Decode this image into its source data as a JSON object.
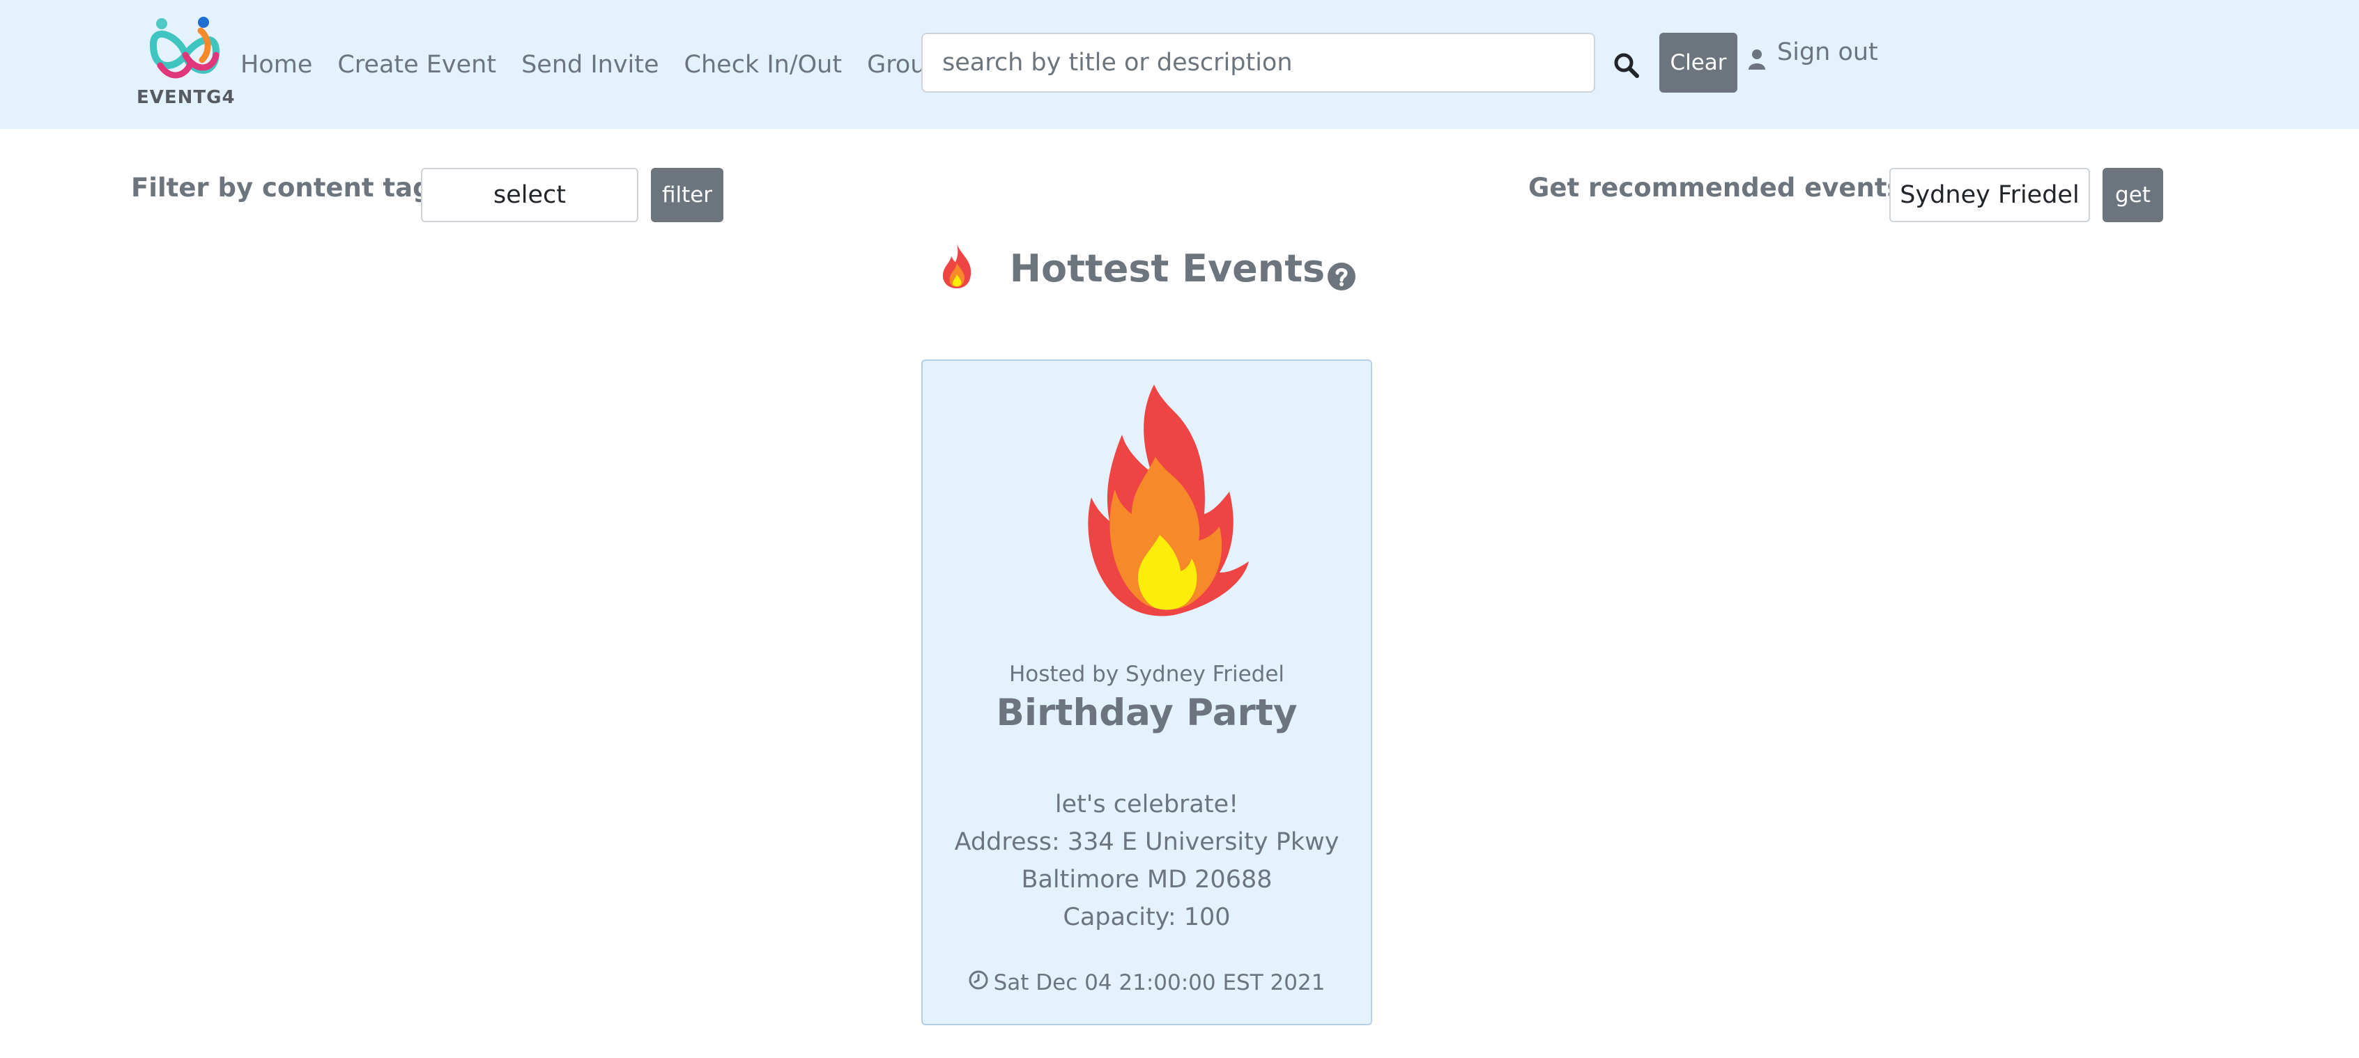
{
  "navbar": {
    "brand_text": "EVENTG4",
    "links": [
      {
        "label": "Home"
      },
      {
        "label": "Create Event"
      },
      {
        "label": "Send Invite"
      },
      {
        "label": "Check In/Out"
      },
      {
        "label": "Groups"
      }
    ],
    "search": {
      "placeholder": "search by title or description",
      "value": ""
    },
    "search_icon": "search-icon",
    "clear_label": "Clear",
    "signout_label": "Sign out",
    "user_icon": "user-icon",
    "background_color": "#e3f2fd"
  },
  "filter": {
    "label": "Filter by content tag:",
    "select_value": "select",
    "button_label": "filter"
  },
  "recommend": {
    "label": "Get recommended events:",
    "select_value": "Sydney Friedel",
    "button_label": "get"
  },
  "hottest": {
    "title": "Hottest Events",
    "icon": "fire-icon",
    "help_icon": "question-circle-icon"
  },
  "events": [
    {
      "hosted_by": "Hosted by Sydney Friedel",
      "title": "Birthday Party",
      "description": "let's celebrate!",
      "address_line1": "Address: 334 E University Pkwy",
      "address_line2": "Baltimore MD 20688",
      "capacity": "Capacity: 100",
      "datetime": "Sat Dec 04 21:00:00 EST 2021",
      "image_icon": "fire-icon",
      "card_color": "#e3f2fd"
    }
  ],
  "colors": {
    "button_gray": "#6c757d",
    "text_gray": "#6c757d",
    "flame_outer": "#ef4444",
    "flame_middle": "#f6892a",
    "flame_inner": "#fcee0a"
  }
}
